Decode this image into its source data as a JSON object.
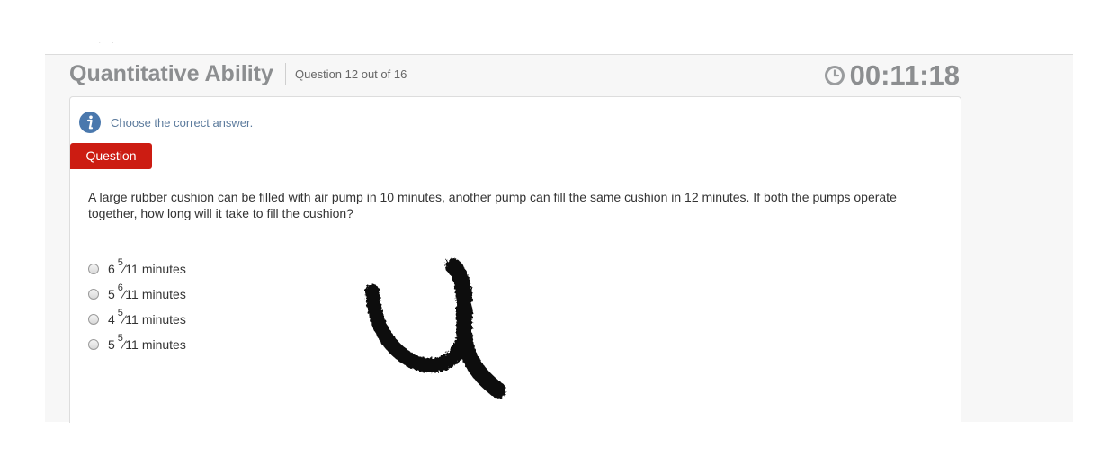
{
  "header": {
    "section_title": "Quantitative Ability",
    "question_counter": "Question 12 out of 16",
    "timer": "00:11:18",
    "timer_icon": "clock-icon"
  },
  "instruction": {
    "icon": "info-icon",
    "text": "Choose the correct answer."
  },
  "tab": {
    "label": "Question"
  },
  "question": {
    "text": "A large rubber cushion can be filled with air pump in 10 minutes, another pump can fill the same cushion in 12 minutes. If both the pumps operate together, how long will it take to fill the cushion?"
  },
  "options": [
    {
      "whole": "6",
      "numerator": "5",
      "slash": "⁄",
      "denominator": "11",
      "unit": "minutes"
    },
    {
      "whole": "5",
      "numerator": "6",
      "slash": "⁄",
      "denominator": "11",
      "unit": "minutes"
    },
    {
      "whole": "4",
      "numerator": "5",
      "slash": "⁄",
      "denominator": "11",
      "unit": "minutes"
    },
    {
      "whole": "5",
      "numerator": "5",
      "slash": "⁄",
      "denominator": "11",
      "unit": "minutes"
    }
  ],
  "colors": {
    "accent_red": "#cc1c12",
    "title_gray": "#8c8e90",
    "info_blue": "#5b7a9c"
  }
}
